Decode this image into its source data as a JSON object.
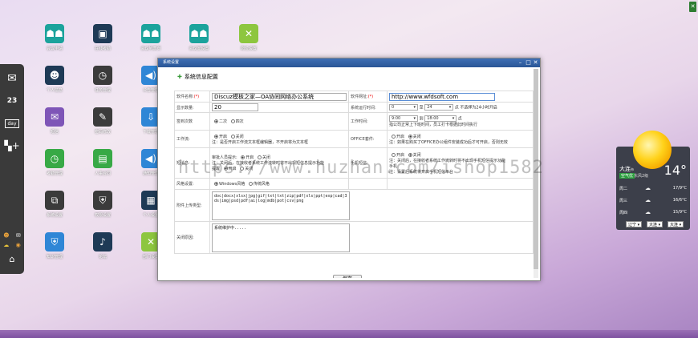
{
  "desktop": {
    "icons": [
      {
        "label": "会议申请",
        "glyph": "☗☗",
        "color": "teal",
        "name": "meeting-apply"
      },
      {
        "label": "在线考勤",
        "glyph": "▣",
        "color": "navy",
        "name": "online-attendance"
      },
      {
        "label": "会议列表页",
        "glyph": "☗☗",
        "color": "teal",
        "name": "meeting-list"
      },
      {
        "label": "会议室设置",
        "glyph": "☗☗",
        "color": "teal",
        "name": "meeting-room-settings"
      },
      {
        "label": "岗位设置",
        "glyph": "✕",
        "color": "lime",
        "name": "position-settings"
      },
      {
        "label": "个人信息",
        "glyph": "☻",
        "color": "navy",
        "name": "personal-info"
      },
      {
        "label": "任务管理",
        "glyph": "◷",
        "color": "dark",
        "name": "task-management"
      },
      {
        "label": "公告管理",
        "glyph": "◀)",
        "color": "blue",
        "name": "announcement-management"
      },
      {
        "label": "短信",
        "glyph": "✉",
        "color": "purple",
        "name": "sms"
      },
      {
        "label": "密码修改",
        "glyph": "✎",
        "color": "dark",
        "name": "password-change"
      },
      {
        "label": "下载管理",
        "glyph": "⇩",
        "color": "blue",
        "name": "download-management"
      },
      {
        "label": "考勤管理",
        "glyph": "◷",
        "color": "green",
        "name": "attendance-management"
      },
      {
        "label": "人事合同",
        "glyph": "▤",
        "color": "green",
        "name": "hr-contract"
      },
      {
        "label": "通知管理",
        "glyph": "◀)",
        "color": "blue",
        "name": "notice-management"
      },
      {
        "label": "系统设置",
        "glyph": "⧉",
        "color": "dark",
        "name": "system-settings"
      },
      {
        "label": "权限设置",
        "glyph": "⛨",
        "color": "dark",
        "name": "permission-settings"
      },
      {
        "label": "个人设置",
        "glyph": "▦",
        "color": "navy",
        "name": "personal-settings"
      },
      {
        "label": "知识管理",
        "glyph": "⛨",
        "color": "blue",
        "name": "knowledge-management"
      },
      {
        "label": "论坛",
        "glyph": "♪",
        "color": "navy",
        "name": "forum"
      },
      {
        "label": "部门设置",
        "glyph": "✕",
        "color": "lime",
        "name": "department-settings"
      }
    ]
  },
  "dock": {
    "items": [
      {
        "icon": "mail-icon",
        "glyph": "✉"
      },
      {
        "icon": "calendar-icon",
        "glyph": "23"
      },
      {
        "icon": "day-view-icon",
        "glyph": "day"
      },
      {
        "icon": "apps-add-icon",
        "glyph": "▚+"
      }
    ],
    "bottom": {
      "home_glyph": "⌂"
    }
  },
  "window": {
    "title": "系统设置",
    "section_title": "系统信息配置",
    "fields": {
      "software_name_label": "软件名称:",
      "software_name_value": "Discuz模板之家—OA协同网络办公系统",
      "software_url_label": "软件网址:",
      "software_url_value": "http://www.wfdsoft.com",
      "display_count_label": "显示数量:",
      "display_count_value": "20",
      "run_time_label": "系统运行时间:",
      "run_time_from": "0",
      "run_time_to_word": "至",
      "run_time_to": "24",
      "run_time_note": "点 不选择为24小时开启",
      "jump_count_label": "签到次数",
      "jump_opt1": "二次",
      "jump_opt2": "四次",
      "work_time_label": "工作时间:",
      "work_time_from": "9:00",
      "work_time_to_word": "到",
      "work_time_to": "18:00",
      "work_time_unit": "点",
      "work_time_note": "指公司正常上下班时间，员工打卡根据此时间执行",
      "workflow_label": "工作流:",
      "workflow_opt1": "开启",
      "workflow_opt2": "关闭",
      "workflow_note": "注：是否开启工作流文本框编辑器，不开启将为文本框",
      "office_label": "OFFICE套件:",
      "office_opt1": "开启",
      "office_opt2": "关闭",
      "office_note": "注：如果在购买了OFFICE办公组件安装成功后才可开启，否则无效",
      "sms_label": "短消息:",
      "sms_sub": "审批人员提示:",
      "sms_opt1": "开启",
      "sms_opt2": "关闭",
      "sms_note": "注：关闭后，在接收者系统工作流转时将不出现短信息提示功能",
      "sms_sub2": "提醒",
      "sms_opt3": "开启",
      "sms_opt4": "关闭",
      "mobile_label": "手机短信:",
      "mobile_opt1": "开启",
      "mobile_opt2": "关闭",
      "mobile_note": "注：关闭后，在接收者系统工作流转时将不出现手机短信提示功能",
      "mobile_sub": "手机",
      "mobile_note2": "注：设置后系统将开启手机短信平台",
      "style_label": "风格设置:",
      "style_opt1": "Windows风格",
      "style_opt2": "传统风格",
      "attach_label": "附件上传类型:",
      "attach_value": "doc|docx|xlsx|jpg|gif|txt|txt|zip|pdf|xls|ppt|exp|cad|3ds|img|psd|pdf|ai|log|mdb|pot|csv|png",
      "close_label": "关闭原因:",
      "close_value": "系统维护中....."
    },
    "save_label": "保存"
  },
  "watermark": "https://www.huzhan.com/ishop1582",
  "weather": {
    "city": "大连",
    "city_sub": "市",
    "temp": "14°",
    "aqi": "空气优",
    "wind": "东风2级",
    "forecast": [
      {
        "day": "周二",
        "temp": "17/9°C"
      },
      {
        "day": "周三",
        "temp": "16/6°C"
      },
      {
        "day": "周四",
        "temp": "15/9°C"
      }
    ],
    "selects": [
      "辽宁",
      "大连",
      "大连"
    ]
  },
  "colors": {
    "accent": "#2a5696",
    "weather_bg": "#3c3f4a",
    "dock_bg": "#3a3a3a"
  }
}
